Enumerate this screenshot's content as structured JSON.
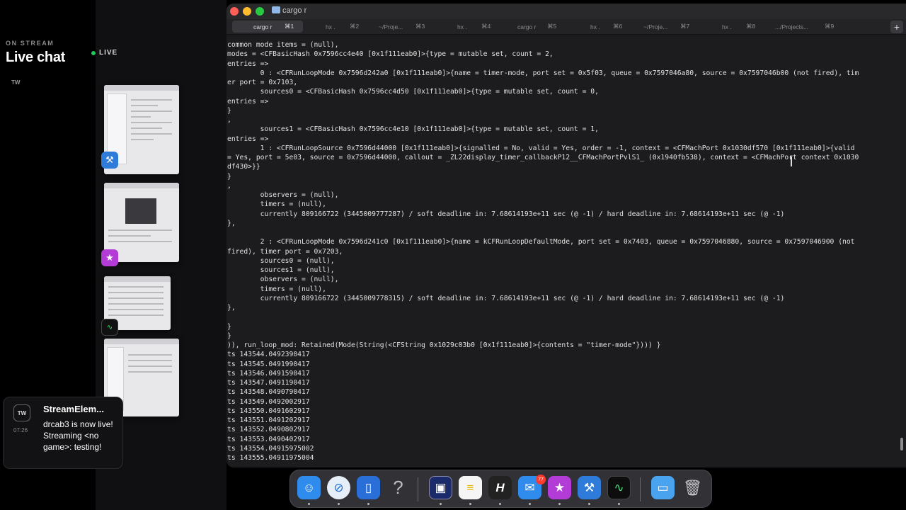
{
  "overlay": {
    "on_stream": "ON STREAM",
    "title": "Live chat",
    "live": "LIVE",
    "tw_label": "TW"
  },
  "notification": {
    "icon_label": "TW",
    "time": "07:26",
    "title": "StreamElem...",
    "body": "drcab3 is now live! Streaming <no game>: testing!"
  },
  "window": {
    "title": "cargo r",
    "tabs": [
      {
        "label": "cargo r",
        "key": "⌘1",
        "active": true
      },
      {
        "label": "hx .",
        "key": "⌘2"
      },
      {
        "label": "~/Proje...",
        "key": "⌘3"
      },
      {
        "label": "hx .",
        "key": "⌘4"
      },
      {
        "label": "cargo r",
        "key": "⌘5"
      },
      {
        "label": "hx .",
        "key": "⌘6"
      },
      {
        "label": "~/Proje...",
        "key": "⌘7"
      },
      {
        "label": "hx .",
        "key": "⌘8"
      },
      {
        "label": ".../Projects...",
        "key": "⌘9"
      }
    ],
    "new_tab": "+"
  },
  "terminal_lines": [
    "common mode items = (null),",
    "modes = <CFBasicHash 0x7596cc4e40 [0x1f111eab0]>{type = mutable set, count = 2,",
    "entries =>",
    "        0 : <CFRunLoopMode 0x7596d242a0 [0x1f111eab0]>{name = timer-mode, port set = 0x5f03, queue = 0x7597046a80, source = 0x7597046b00 (not fired), tim",
    "er port = 0x7103,",
    "        sources0 = <CFBasicHash 0x7596cc4d50 [0x1f111eab0]>{type = mutable set, count = 0,",
    "entries =>",
    "}",
    ",",
    "        sources1 = <CFBasicHash 0x7596cc4e10 [0x1f111eab0]>{type = mutable set, count = 1,",
    "entries =>",
    "        1 : <CFRunLoopSource 0x7596d44000 [0x1f111eab0]>{signalled = No, valid = Yes, order = -1, context = <CFMachPort 0x1030df570 [0x1f111eab0]>{valid",
    "= Yes, port = 5e03, source = 0x7596d44000, callout = _ZL22display_timer_callbackP12__CFMachPortPvlS1_ (0x1940fb538), context = <CFMachPort context 0x1030",
    "df430>}}",
    "}",
    ",",
    "        observers = (null),",
    "        timers = (null),",
    "        currently 809166722 (3445009777287) / soft deadline in: 7.68614193e+11 sec (@ -1) / hard deadline in: 7.68614193e+11 sec (@ -1)",
    "},",
    "",
    "        2 : <CFRunLoopMode 0x7596d241c0 [0x1f111eab0]>{name = kCFRunLoopDefaultMode, port set = 0x7403, queue = 0x7597046880, source = 0x7597046900 (not",
    "fired), timer port = 0x7203,",
    "        sources0 = (null),",
    "        sources1 = (null),",
    "        observers = (null),",
    "        timers = (null),",
    "        currently 809166722 (3445009778315) / soft deadline in: 7.68614193e+11 sec (@ -1) / hard deadline in: 7.68614193e+11 sec (@ -1)",
    "},",
    "",
    "}",
    "}",
    ")), run_loop_mod: Retained(Mode(String(<CFString 0x1029c03b0 [0x1f111eab0]>{contents = \"timer-mode\"}))) }",
    "ts 143544.0492390417",
    "ts 143545.0491990417",
    "ts 143546.0491590417",
    "ts 143547.0491190417",
    "ts 143548.0490790417",
    "ts 143549.0492002917",
    "ts 143550.0491602917",
    "ts 143551.0491202917",
    "ts 143552.0490802917",
    "ts 143553.0490402917",
    "ts 143554.04915975002",
    "ts 143555.04911975004"
  ],
  "dock": {
    "mail_badge": "77",
    "apps": [
      "finder-icon",
      "safari-icon",
      "files-icon",
      "help-icon",
      "terminal-icon",
      "notes-icon",
      "hx-icon",
      "mail-icon",
      "star-icon",
      "xcode-icon",
      "activity-monitor-icon",
      "folder-icon",
      "trash-icon"
    ]
  },
  "colors": {
    "terminal_bg": "#1c1c1e",
    "live_dot": "#22c55e",
    "close": "#ff5f57",
    "minimize": "#febc2e",
    "maximize": "#28c840"
  }
}
